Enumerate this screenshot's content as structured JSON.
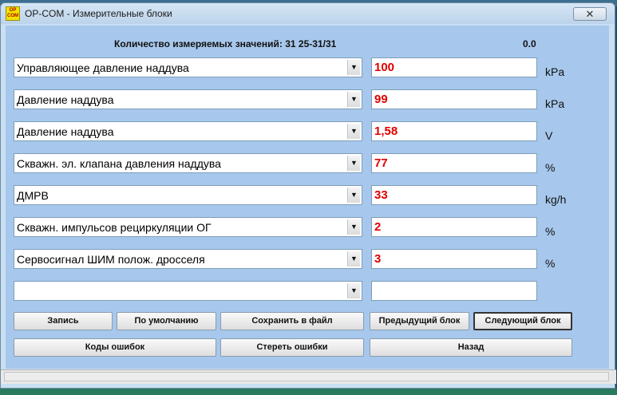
{
  "window": {
    "icon_text": "OP COM",
    "title": "OP-COM - Измерительные блоки",
    "close_glyph": "✕"
  },
  "header": {
    "count_label": "Количество измеряемых значений: 31  25-31/31",
    "time_value": "0.0"
  },
  "rows": [
    {
      "label": "Управляющее давление наддува",
      "value": "100",
      "unit": "kPa"
    },
    {
      "label": "Давление наддува",
      "value": "99",
      "unit": "kPa"
    },
    {
      "label": "Давление наддува",
      "value": "1,58",
      "unit": "V"
    },
    {
      "label": "Скважн. эл. клапана давления наддува",
      "value": "77",
      "unit": "%"
    },
    {
      "label": "ДМРВ",
      "value": "33",
      "unit": "kg/h"
    },
    {
      "label": "Скважн. импульсов рециркуляции ОГ",
      "value": "2",
      "unit": "%"
    },
    {
      "label": "Сервосигнал ШИМ полож. дросселя",
      "value": "3",
      "unit": "%"
    },
    {
      "label": "",
      "value": "",
      "unit": ""
    }
  ],
  "buttons": {
    "record": "Запись",
    "default": "По умолчанию",
    "save_file": "Сохранить в файл",
    "prev_block": "Предыдущий блок",
    "next_block": "Следующий блок",
    "error_codes": "Коды ошибок",
    "clear_errors": "Стереть ошибки",
    "back": "Назад"
  },
  "icons": {
    "dropdown": "chevron-down-icon",
    "close": "close-icon"
  },
  "colors": {
    "client_bg": "#a7c8ec",
    "value_text": "#e00000"
  }
}
